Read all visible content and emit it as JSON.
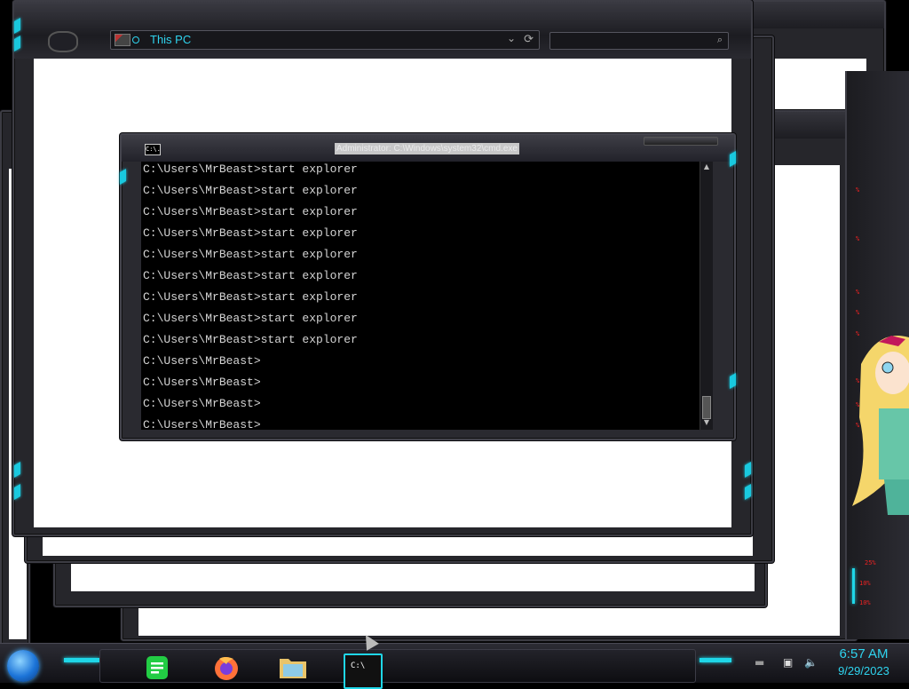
{
  "explorer": {
    "address": "This PC"
  },
  "cmd": {
    "icon_text": "C:\\.",
    "title": "Administrator: C:\\Windows\\system32\\cmd.exe",
    "lines": [
      "C:\\Users\\MrBeast>start explorer",
      "C:\\Users\\MrBeast>start explorer",
      "C:\\Users\\MrBeast>start explorer",
      "C:\\Users\\MrBeast>start explorer",
      "C:\\Users\\MrBeast>start explorer",
      "C:\\Users\\MrBeast>start explorer",
      "C:\\Users\\MrBeast>start explorer",
      "C:\\Users\\MrBeast>start explorer",
      "C:\\Users\\MrBeast>start explorer",
      "C:\\Users\\MrBeast>",
      "C:\\Users\\MrBeast>",
      "C:\\Users\\MrBeast>",
      "C:\\Users\\MrBeast>"
    ]
  },
  "gadget": {
    "readouts": [
      "%",
      "%",
      "%",
      "%",
      "%",
      "%",
      "%",
      "%",
      "25%",
      "10%",
      "10%"
    ]
  },
  "taskbar": {
    "apps": [
      {
        "name": "start-orb-button",
        "icon": "windows-orb-icon"
      },
      {
        "name": "notes-app",
        "icon": "green-notes-icon"
      },
      {
        "name": "firefox",
        "icon": "firefox-icon"
      },
      {
        "name": "file-explorer",
        "icon": "folder-icon"
      },
      {
        "name": "cmd",
        "icon": "console-icon",
        "label": "C:\\"
      }
    ],
    "clock": {
      "time": "6:57 AM",
      "date": "9/29/2023"
    }
  },
  "colors": {
    "accent": "#1fd7e8",
    "frame": "#26262b",
    "console_bg": "#000000",
    "console_fg": "#d4d4d4",
    "clock": "#2fd4ef"
  }
}
